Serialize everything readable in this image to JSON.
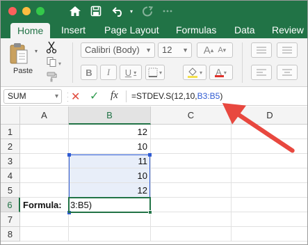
{
  "window": {
    "traffic_lights": [
      "close",
      "minimize",
      "zoom"
    ],
    "toolbar_icons": [
      "home-icon",
      "save-icon",
      "undo-icon",
      "redo-icon"
    ]
  },
  "tabs": [
    {
      "label": "Home",
      "active": true
    },
    {
      "label": "Insert"
    },
    {
      "label": "Page Layout"
    },
    {
      "label": "Formulas"
    },
    {
      "label": "Data"
    },
    {
      "label": "Review"
    }
  ],
  "ribbon": {
    "paste_label": "Paste",
    "font_name": "Calibri (Body)",
    "font_size": "12",
    "grow_font": "A",
    "shrink_font": "A",
    "bold": "B",
    "italic": "I",
    "underline": "U",
    "font_color_letter": "A",
    "highlight_color": "#f4e04d",
    "font_color": "#e0302a"
  },
  "formula_bar": {
    "name_box": "SUM",
    "fx_label": "fx",
    "formula_prefix": "=STDEV.S(12,10,",
    "formula_ref": "B3:B5",
    "formula_suffix": ")"
  },
  "sheet": {
    "columns": [
      "A",
      "B",
      "C",
      "D"
    ],
    "rows": [
      "1",
      "2",
      "3",
      "4",
      "5",
      "6",
      "7",
      "8"
    ],
    "values_b": [
      "12",
      "10",
      "11",
      "10",
      "12"
    ],
    "a6_label": "Formula:",
    "b6_edit": "3:B5)"
  },
  "colors": {
    "excel_green": "#217346",
    "ref_blue": "#2f5bd3",
    "arrow_red": "#e8483f"
  }
}
